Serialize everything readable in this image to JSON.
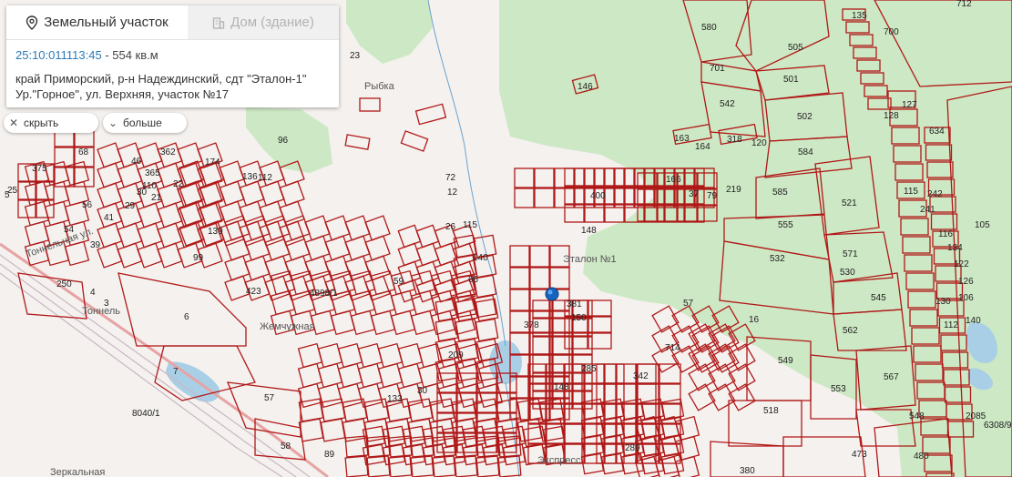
{
  "card": {
    "tabs": [
      {
        "label": "Земельный участок",
        "icon": "map-pin-icon",
        "active": true
      },
      {
        "label": "Дом (здание)",
        "icon": "building-icon",
        "active": false
      }
    ],
    "cadastral_number": "25:10:011113:45",
    "area_text": " - 554 кв.м",
    "address_line1": "край Приморский, р-н Надеждинский, сдт \"Эталон-1\"",
    "address_line2": "Ур.\"Горное\", ул. Верхняя, участок №17"
  },
  "controls": {
    "hide_label": "скрыть",
    "hide_icon": "close-icon",
    "more_label": "больше",
    "more_icon": "chevron-down-icon"
  },
  "map": {
    "colors": {
      "parcel_stroke": "#b01818",
      "forest": "#cde8c4",
      "water": "#a9cfe6",
      "marker": "#1565c0"
    },
    "place_labels": [
      "Рыбка",
      "Тоннельная ул.",
      "Тоннель",
      "Жемчужная",
      "Эталон №1",
      "Экспресс",
      "Зеркальная"
    ],
    "parcel_labels": [
      "580",
      "712",
      "135",
      "700",
      "505",
      "701",
      "501",
      "542",
      "502",
      "163",
      "164",
      "318",
      "120",
      "584",
      "146",
      "23",
      "375",
      "68",
      "362",
      "46",
      "365",
      "110",
      "21",
      "30",
      "22",
      "174",
      "136",
      "112",
      "29",
      "56",
      "41",
      "99",
      "139",
      "39",
      "250",
      "4",
      "3",
      "6",
      "7",
      "57",
      "8040/1",
      "58",
      "89",
      "4898/1",
      "423",
      "59",
      "209",
      "30",
      "133",
      "115",
      "140",
      "66",
      "72",
      "12",
      "26",
      "400",
      "148",
      "166",
      "37",
      "79",
      "219",
      "585",
      "521",
      "555",
      "532",
      "571",
      "530",
      "545",
      "562",
      "549",
      "553",
      "567",
      "518",
      "548",
      "473",
      "480",
      "380",
      "381",
      "150",
      "378",
      "148",
      "285",
      "342",
      "289",
      "57",
      "16",
      "714",
      "105",
      "127",
      "128",
      "115",
      "242",
      "241",
      "116",
      "134",
      "122",
      "126",
      "106",
      "140",
      "130",
      "112",
      "634",
      "6308/9",
      "2085",
      "96",
      "5",
      "25",
      "54"
    ],
    "marker_icon": "location-pin-icon"
  }
}
